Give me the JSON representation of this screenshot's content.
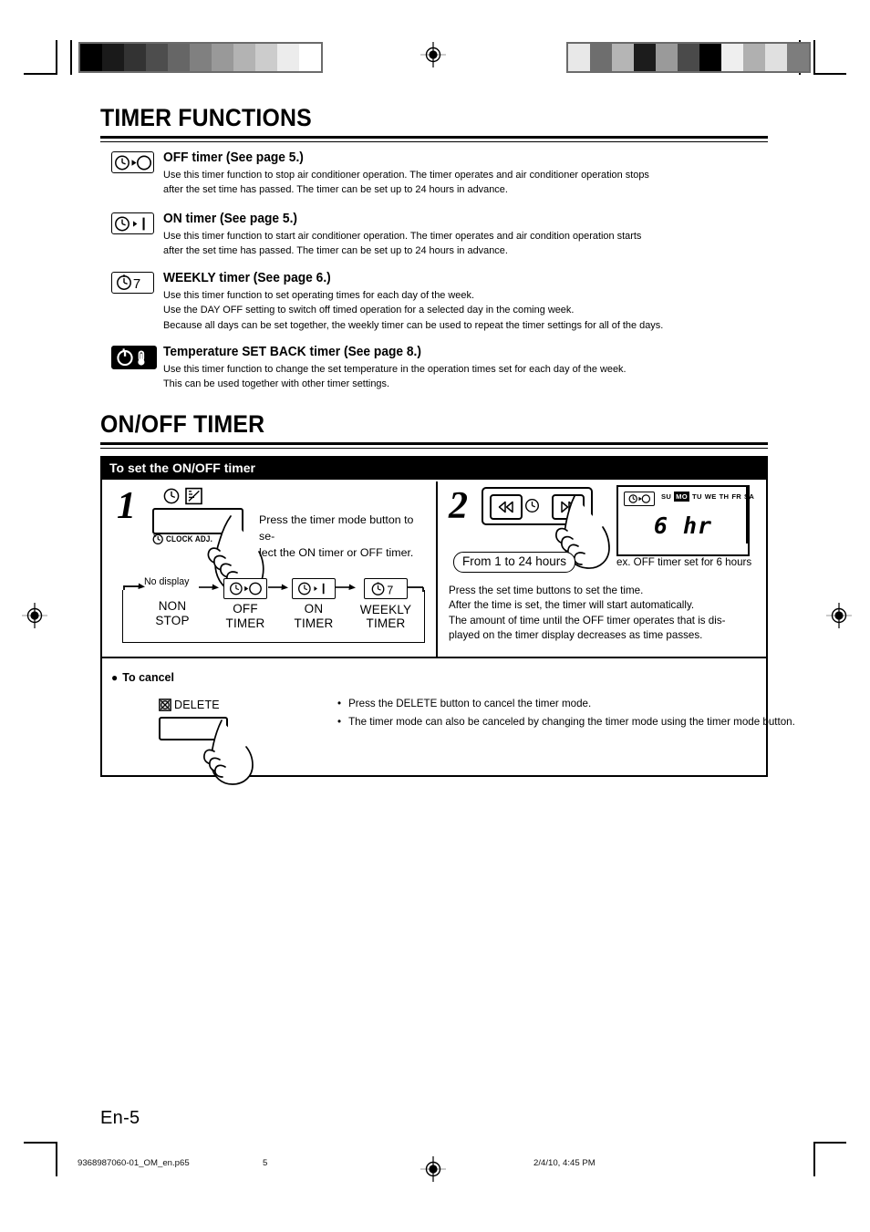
{
  "document": {
    "page_label": "En-5",
    "footer": {
      "filename": "9368987060-01_OM_en.p65",
      "page": "5",
      "timestamp": "2/4/10, 4:45 PM"
    }
  },
  "sections": {
    "timer_functions": {
      "heading": "TIMER FUNCTIONS",
      "items": [
        {
          "icon": "off-timer-icon",
          "title": "OFF timer (See page 5.)",
          "lines": [
            "Use this timer function to stop air conditioner operation. The timer operates and air conditioner operation stops",
            "after the set time has passed. The timer can be set up to 24 hours in advance."
          ]
        },
        {
          "icon": "on-timer-icon",
          "title": "ON timer (See page 5.)",
          "lines": [
            "Use this timer function to start air conditioner operation. The timer operates and air condition operation starts",
            "after the set time has passed. The timer can be set up to 24 hours in advance."
          ]
        },
        {
          "icon": "weekly-timer-icon",
          "title": "WEEKLY timer (See page 6.)",
          "lines": [
            "Use this timer function to set operating times for each day of the week.",
            "Use the DAY OFF setting to switch off timed operation for a selected day in the coming week.",
            "Because all days can be set together, the weekly timer can be used to repeat the timer settings for all of the days."
          ]
        },
        {
          "icon": "set-back-timer-icon",
          "title": "Temperature SET BACK timer (See page 8.)",
          "lines": [
            "Use this timer function to change the set temperature in the operation times set for each day of the week.",
            "This can be used together with other timer settings."
          ]
        }
      ]
    },
    "on_off_timer": {
      "heading": "ON/OFF TIMER",
      "panel_title": "To set the ON/OFF timer",
      "step1": {
        "number": "1",
        "button_label": "CLOCK ADJ.",
        "instruction_lines": [
          "Press the timer mode button to se-",
          "lect the ON timer or OFF timer."
        ]
      },
      "step2": {
        "number": "2",
        "range_pill": "From 1 to 24 hours",
        "example_caption": "ex. OFF timer set for 6 hours",
        "instruction_lines": [
          "Press the set time buttons to set the time.",
          "After the time is set, the timer will start automatically.",
          "The amount of time until the OFF timer operates that is dis-",
          "played on the timer display decreases as time passes."
        ],
        "lcd": {
          "mode_icon": "off-timer-icon",
          "days": [
            "SU",
            "MO",
            "TU",
            "WE",
            "TH",
            "FR",
            "SA"
          ],
          "active_day": "MO",
          "value": "6 hr"
        }
      },
      "cycle_diagram": {
        "no_display_label": "No display",
        "nodes": [
          {
            "icon": "none",
            "label_line1": "NON",
            "label_line2": "STOP"
          },
          {
            "icon": "off-timer-icon",
            "label_line1": "OFF",
            "label_line2": "TIMER"
          },
          {
            "icon": "on-timer-icon",
            "label_line1": "ON",
            "label_line2": "TIMER"
          },
          {
            "icon": "weekly-timer-icon",
            "label_line1": "WEEKLY",
            "label_line2": "TIMER"
          }
        ]
      },
      "cancel": {
        "heading": "To cancel",
        "button_label": "DELETE",
        "bullets": [
          "Press the DELETE button to cancel the timer mode.",
          "The timer mode can also be canceled by changing the timer mode using the timer mode button."
        ]
      }
    }
  },
  "print_marks": {
    "wedge_left": [
      "#000000",
      "#1a1a1a",
      "#333333",
      "#4d4d4d",
      "#666666",
      "#808080",
      "#999999",
      "#b3b3b3",
      "#cccccc",
      "#ececec",
      "#ffffff"
    ],
    "wedge_right": [
      "#e8e8e8",
      "#6e6e6e",
      "#b5b5b5",
      "#1c1c1c",
      "#9a9a9a",
      "#4a4a4a",
      "#000000",
      "#efefef",
      "#b0b0b0",
      "#e0e0e0",
      "#7d7d7d"
    ]
  }
}
